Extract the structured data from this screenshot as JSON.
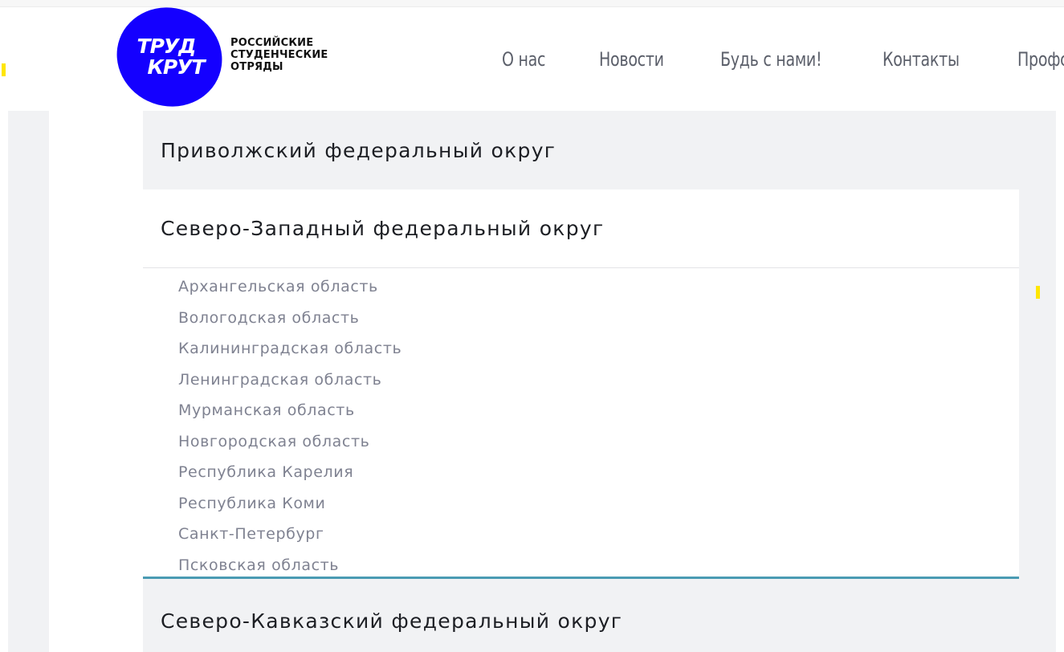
{
  "header": {
    "logo": {
      "mark_line1": "ТРУД",
      "mark_line2": "КРУТ",
      "text_line1": "РОССИЙСКИЕ",
      "text_line2": "СТУДЕНЧЕСКИЕ",
      "text_line3": "ОТРЯДЫ",
      "brand_color": "#1400ff"
    },
    "nav": [
      {
        "label": "О нас"
      },
      {
        "label": "Новости"
      },
      {
        "label": "Будь с нами!"
      },
      {
        "label": "Контакты"
      },
      {
        "label": "Профс"
      }
    ]
  },
  "districts": [
    {
      "title": "Приволжский федеральный округ",
      "expanded": false
    },
    {
      "title": "Северо-Западный федеральный округ",
      "expanded": true,
      "regions": [
        "Архангельская область",
        "Вологодская область",
        "Калининградская область",
        "Ленинградская область",
        "Мурманская область",
        "Новгородская область",
        "Республика Карелия",
        "Республика Коми",
        "Санкт-Петербург",
        "Псковская область"
      ]
    },
    {
      "title": "Северо-Кавказский федеральный округ",
      "expanded": false
    }
  ],
  "colors": {
    "accent_line": "#4a9bb3",
    "panel_bg": "#f1f2f4",
    "marker_yellow": "#ffe600"
  }
}
